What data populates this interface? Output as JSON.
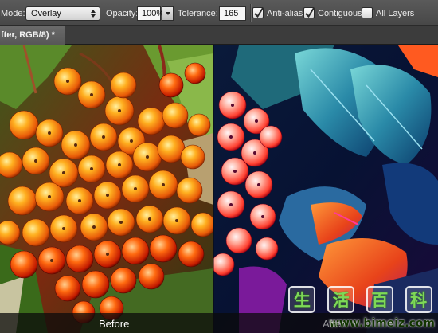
{
  "options_bar": {
    "mode_label": "Mode:",
    "mode_value": "Overlay",
    "opacity_label": "Opacity:",
    "opacity_value": "100%",
    "tolerance_label": "Tolerance:",
    "tolerance_value": "165",
    "anti_alias": {
      "label": "Anti-alias",
      "checked": true
    },
    "contiguous": {
      "label": "Contiguous",
      "checked": true
    },
    "all_layers": {
      "label": "All Layers",
      "checked": false
    }
  },
  "document_tab": {
    "title": "fter, RGB/8) *"
  },
  "canvas": {
    "before_label": "Before",
    "after_label": "After"
  },
  "watermark": {
    "chars": [
      "生",
      "活",
      "百",
      "科"
    ],
    "url": "www.bimeiz.com"
  }
}
